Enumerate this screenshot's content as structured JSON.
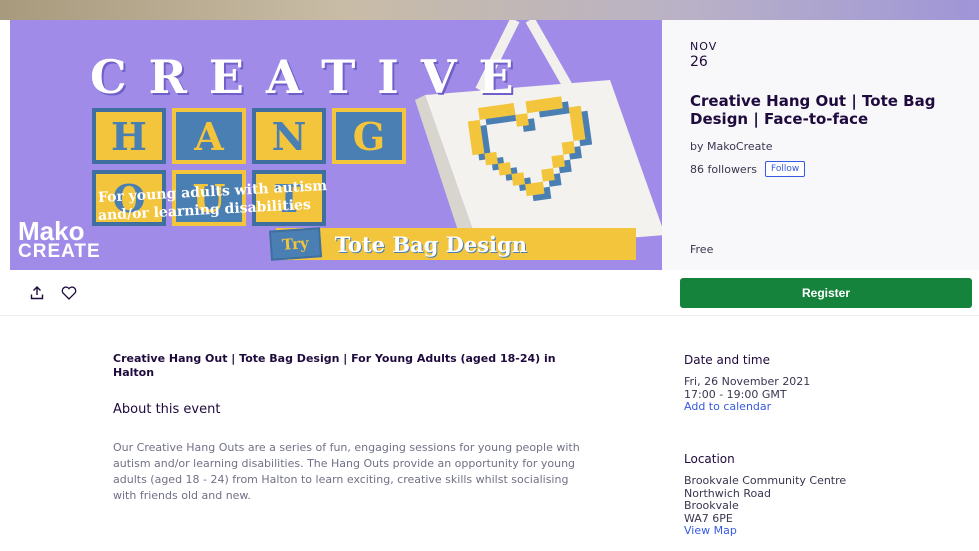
{
  "banner": {
    "creative_word": "CREATIVE",
    "hang_tiles": [
      "H",
      "A",
      "N",
      "G"
    ],
    "out_tiles": [
      "O",
      "U",
      "T"
    ],
    "subtitle_line1": "For young adults with autism",
    "subtitle_line2": "and/or learning disabilities",
    "logo_line1": "Mako",
    "logo_line2": "CREATE",
    "try_label": "Try",
    "try_text": "Tote Bag Design",
    "colors": {
      "background": "#a08ce8",
      "yellow": "#f3c53c",
      "blue": "#4a7fb3"
    }
  },
  "event_panel": {
    "month": "NOV",
    "day": "26",
    "title": "Creative Hang Out | Tote Bag Design | Face-to-face",
    "organizer": "by MakoCreate",
    "followers": "86 followers",
    "follow_label": "Follow",
    "price": "Free"
  },
  "actions": {
    "share_icon": "share-icon",
    "like_icon": "heart-icon",
    "register_label": "Register",
    "register_color": "#16833d"
  },
  "main": {
    "headline": "Creative Hang Out | Tote Bag Design | For Young Adults (aged 18-24) in Halton",
    "about_title": "About this event",
    "about_body": "Our Creative Hang Outs are a series of fun, engaging sessions for young people with autism and/or learning disabilities. The Hang Outs provide an opportunity for young adults (aged 18 - 24) from Halton to learn exciting, creative skills whilst socialising with friends old and new."
  },
  "sidebar": {
    "date_heading": "Date and time",
    "date_line": "Fri, 26 November 2021",
    "time_line": "17:00 - 19:00 GMT",
    "add_to_calendar": "Add to calendar",
    "location_heading": "Location",
    "location_lines": [
      "Brookvale Community Centre",
      "Northwich Road",
      "Brookvale",
      "WA7 6PE"
    ],
    "view_map": "View Map"
  }
}
